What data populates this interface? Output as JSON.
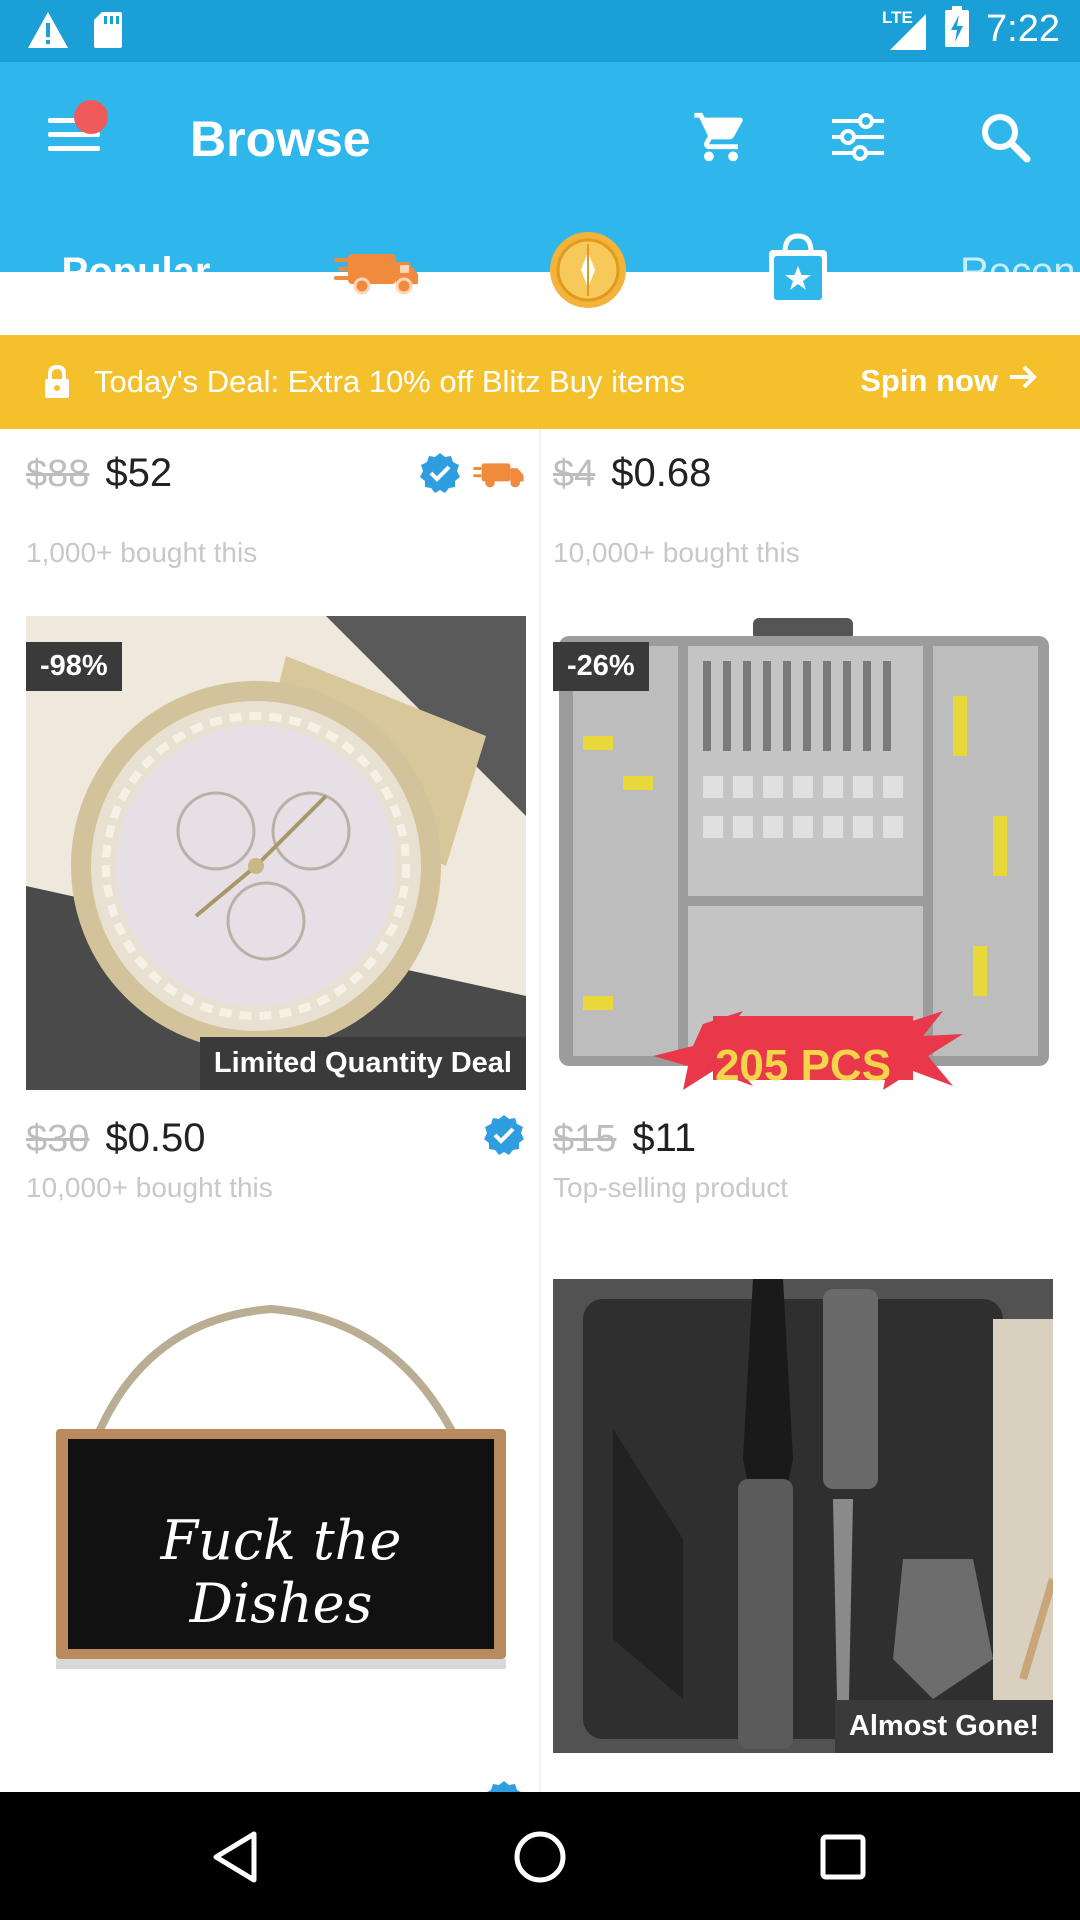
{
  "status_bar": {
    "network": "LTE",
    "time": "7:22"
  },
  "header": {
    "title": "Browse"
  },
  "tabs": {
    "popular": "Popular",
    "recent": "Recen"
  },
  "deal_banner": {
    "text": "Today's Deal: Extra 10% off Blitz Buy items",
    "cta": "Spin now"
  },
  "products": [
    {
      "old_price": "$88",
      "price": "$52",
      "subtitle": "1,000+ bought this"
    },
    {
      "old_price": "$4",
      "price": "$0.68",
      "subtitle": "10,000+ bought this"
    },
    {
      "discount": "-98%",
      "ribbon": "Limited Quantity Deal",
      "old_price": "$30",
      "price": "$0.50",
      "subtitle": "10,000+ bought this"
    },
    {
      "discount": "-26%",
      "image_text": "205 PCS",
      "old_price": "$15",
      "price": "$11",
      "subtitle": "Top-selling product"
    },
    {
      "image_text": "Fuck the Dishes"
    },
    {
      "ribbon": "Almost Gone!"
    }
  ],
  "colors": {
    "app_bar": "#2fb7ec",
    "status_bar": "#1a9fd6",
    "deal_banner": "#f4c02c",
    "verified": "#2f9ee0",
    "truck": "#f08a3c"
  },
  "icons": [
    "warning-icon",
    "sd-card-icon",
    "signal-icon",
    "battery-icon",
    "menu-icon",
    "cart-icon",
    "filter-icon",
    "search-icon",
    "express-truck-icon",
    "coin-icon",
    "bag-icon",
    "lock-icon",
    "arrow-right-icon",
    "verified-icon",
    "back-icon",
    "home-icon",
    "recents-icon"
  ]
}
